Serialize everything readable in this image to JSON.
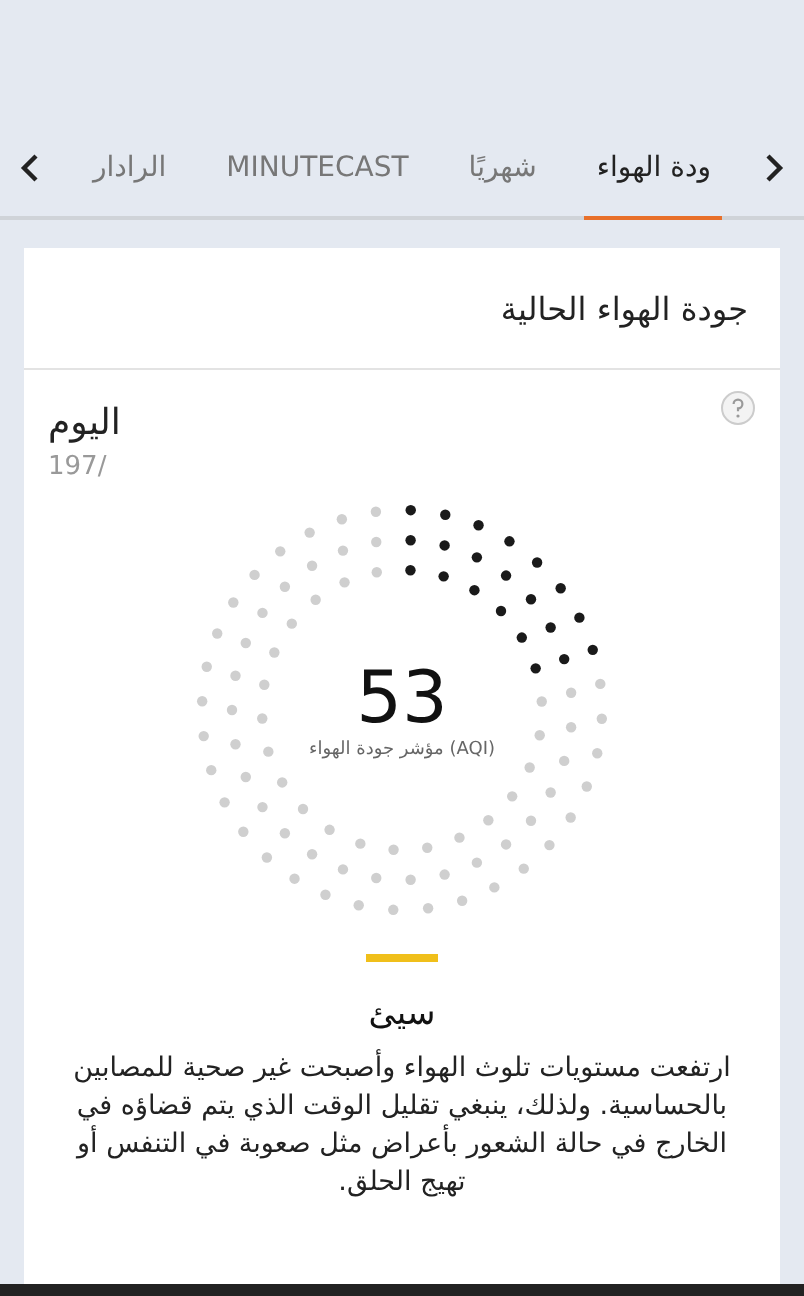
{
  "tabs": [
    {
      "label": "ودة الهواء",
      "selected": true
    },
    {
      "label": "شهريًا",
      "selected": false
    },
    {
      "label": "MINUTECAST",
      "selected": false
    },
    {
      "label": "الرادار",
      "selected": false
    }
  ],
  "card": {
    "title": "جودة الهواء الحالية"
  },
  "today": {
    "label": "اليوم",
    "date": "197/"
  },
  "aqi": {
    "value": "53",
    "caption": "مؤشر جودة الهواء (AQI)",
    "color": "#f0bf1a",
    "category": "سيئ",
    "description": "ارتفعت مستويات تلوث الهواء وأصبحت غير صحية للمصابين بالحساسية. ولذلك، ينبغي تقليل الوقت الذي يتم قضاؤه في الخارج في حالة الشعور بأعراض مثل صعوبة في التنفس أو تهيج الحلق."
  }
}
